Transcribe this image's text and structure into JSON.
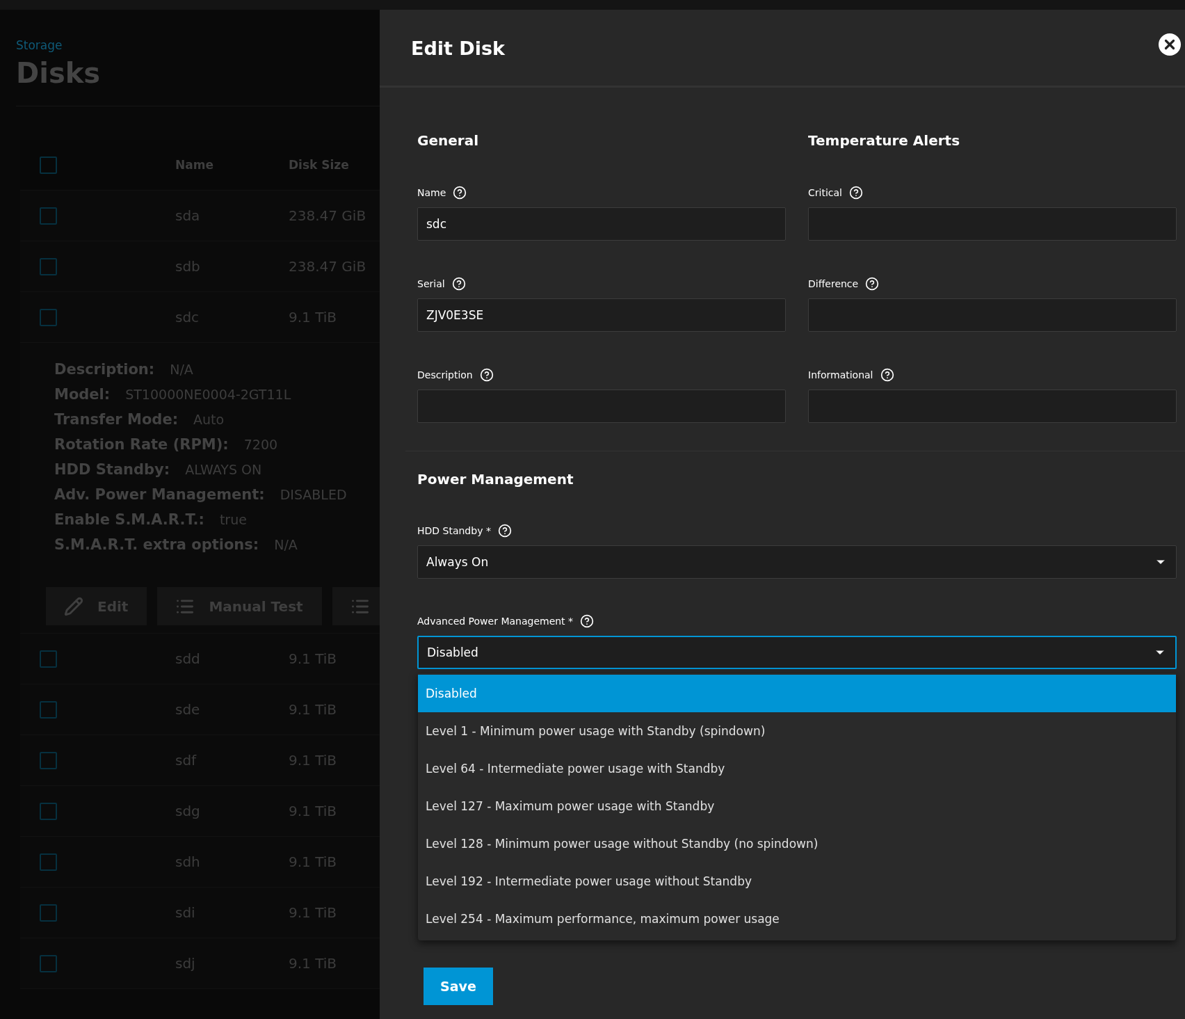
{
  "page": {
    "breadcrumb": "Storage",
    "title": "Disks"
  },
  "disks_table": {
    "columns": [
      "Name",
      "Disk Size"
    ],
    "header_checked": false,
    "rows": [
      {
        "name": "sda",
        "size": "238.47 GiB",
        "checked": false
      },
      {
        "name": "sdb",
        "size": "238.47 GiB",
        "checked": false
      },
      {
        "name": "sdc",
        "size": "9.1 TiB",
        "checked": false,
        "details": [
          {
            "label": "Description:",
            "value": "N/A"
          },
          {
            "label": "Model:",
            "value": "ST10000NE0004-2GT11L"
          },
          {
            "label": "Transfer Mode:",
            "value": "Auto"
          },
          {
            "label": "Rotation Rate (RPM):",
            "value": "7200"
          },
          {
            "label": "HDD Standby:",
            "value": "ALWAYS ON"
          },
          {
            "label": "Adv. Power Management:",
            "value": "DISABLED"
          },
          {
            "label": "Enable S.M.A.R.T.:",
            "value": "true"
          },
          {
            "label": "S.M.A.R.T. extra options:",
            "value": "N/A"
          }
        ],
        "actions": [
          "Edit",
          "Manual Test"
        ]
      },
      {
        "name": "sdd",
        "size": "9.1 TiB",
        "checked": false
      },
      {
        "name": "sde",
        "size": "9.1 TiB",
        "checked": false
      },
      {
        "name": "sdf",
        "size": "9.1 TiB",
        "checked": false
      },
      {
        "name": "sdg",
        "size": "9.1 TiB",
        "checked": false
      },
      {
        "name": "sdh",
        "size": "9.1 TiB",
        "checked": false
      },
      {
        "name": "sdi",
        "size": "9.1 TiB",
        "checked": false
      },
      {
        "name": "sdj",
        "size": "9.1 TiB",
        "checked": false
      }
    ]
  },
  "dialog": {
    "title": "Edit Disk",
    "columns": [
      {
        "heading": "General",
        "fields": [
          {
            "label": "Name",
            "value": "sdc"
          },
          {
            "label": "Serial",
            "value": "ZJV0E3SE"
          },
          {
            "label": "Description"
          }
        ]
      },
      {
        "heading": "Temperature Alerts",
        "fields": [
          {
            "label": "Critical"
          },
          {
            "label": "Difference"
          },
          {
            "label": "Informational"
          }
        ]
      }
    ],
    "power": {
      "heading": "Power Management",
      "selects": [
        {
          "label": "HDD Standby *",
          "value": "Always On",
          "focused": false
        },
        {
          "label": "Advanced Power Management *",
          "value": "Disabled",
          "focused": true,
          "options": [
            {
              "label": "Disabled",
              "selected": true
            },
            {
              "label": "Level 1 - Minimum power usage with Standby (spindown)",
              "selected": false
            },
            {
              "label": "Level 64 - Intermediate power usage with Standby",
              "selected": false
            },
            {
              "label": "Level 127 - Maximum power usage with Standby",
              "selected": false
            },
            {
              "label": "Level 128 - Minimum power usage without Standby (no spindown)",
              "selected": false
            },
            {
              "label": "Level 192 - Intermediate power usage without Standby",
              "selected": false
            },
            {
              "label": "Level 254 - Maximum performance, maximum power usage",
              "selected": false
            }
          ]
        }
      ]
    },
    "save_button": "Save"
  }
}
